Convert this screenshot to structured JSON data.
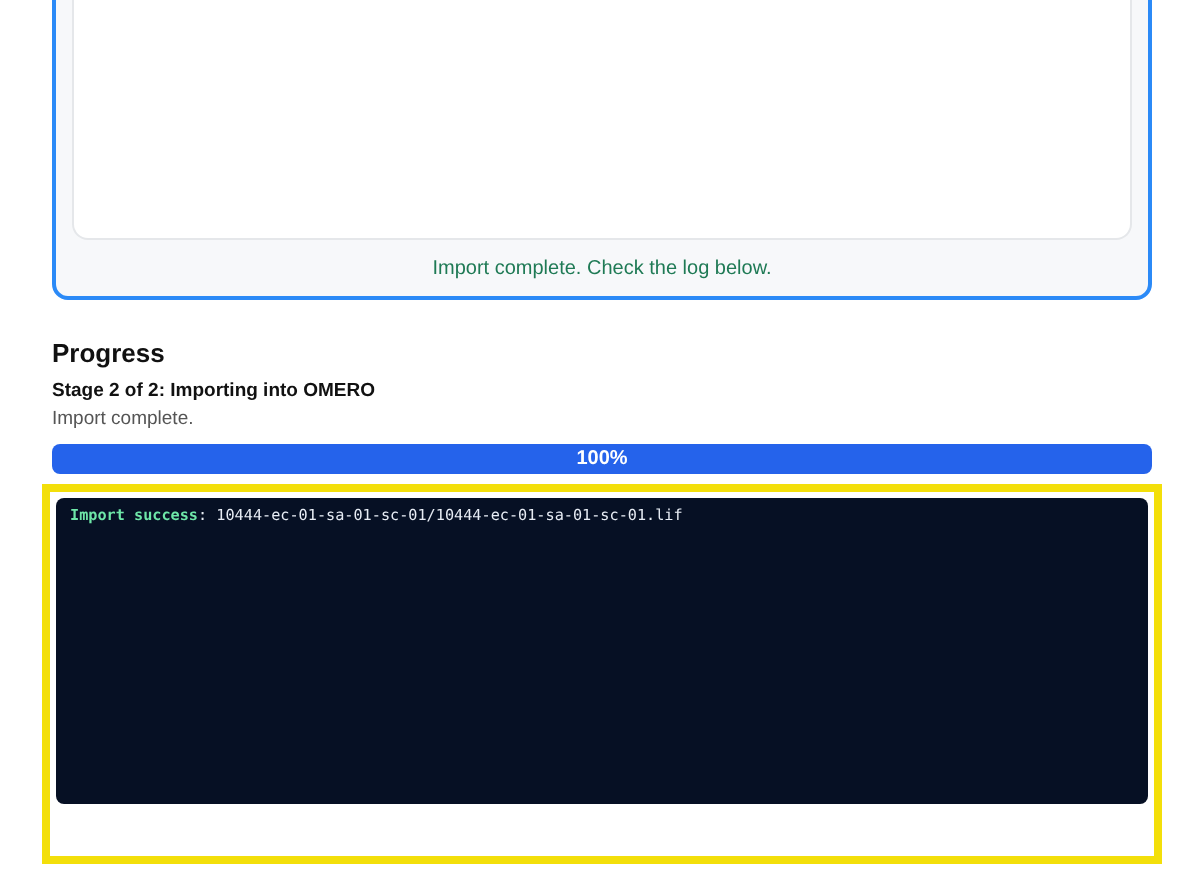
{
  "upload_panel": {
    "status": "Import complete. Check the log below."
  },
  "progress": {
    "heading": "Progress",
    "stage": "Stage 2 of 2: Importing into OMERO",
    "detail": "Import complete.",
    "level": 1,
    "label": "100%"
  },
  "log": {
    "highlighted": true,
    "lines": [
      {
        "label": "Import success",
        "text": ": 10444-ec-01-sa-01-sc-01/10444-ec-01-sa-01-sc-01.lif"
      }
    ]
  }
}
